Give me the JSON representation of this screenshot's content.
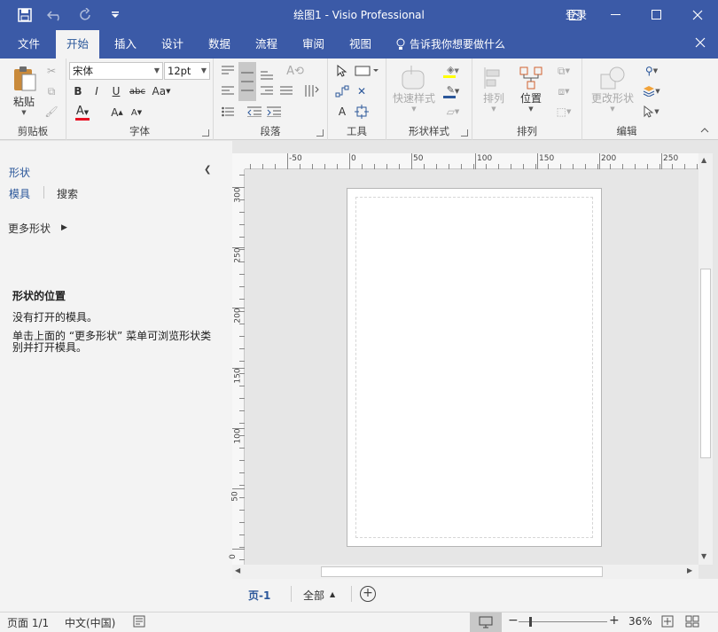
{
  "titlebar": {
    "title": "绘图1 - Visio Professional",
    "login": "登录"
  },
  "tabs": [
    "文件",
    "开始",
    "插入",
    "设计",
    "数据",
    "流程",
    "审阅",
    "视图"
  ],
  "tellme": "告诉我你想要做什么",
  "ribbon": {
    "clipboard": {
      "label": "剪贴板",
      "paste": "粘贴"
    },
    "font": {
      "label": "字体",
      "font_name": "宋体",
      "font_size": "12pt"
    },
    "paragraph": {
      "label": "段落"
    },
    "tools": {
      "label": "工具"
    },
    "shapestyles": {
      "label": "形状样式",
      "quick_styles": "快速样式"
    },
    "arrange": {
      "label": "排列",
      "arrange_btn": "排列",
      "position": "位置"
    },
    "editing": {
      "label": "编辑",
      "change_shape": "更改形状"
    }
  },
  "shapes_panel": {
    "title": "形状",
    "tab_stencils": "模具",
    "tab_search": "搜索",
    "more_shapes": "更多形状",
    "info_title": "形状的位置",
    "info_line1": "没有打开的模具。",
    "info_line2": "单击上面的 “更多形状” 菜单可浏览形状类别并打开模具。"
  },
  "rulers": {
    "h_labels": [
      "-50",
      "0",
      "50",
      "100",
      "150",
      "200",
      "250"
    ],
    "v_labels": [
      "300",
      "250",
      "200",
      "150",
      "100",
      "50",
      "0"
    ]
  },
  "page_tabs": {
    "page": "页-1",
    "all": "全部"
  },
  "status": {
    "page": "页面 1/1",
    "language": "中文(中国)",
    "zoom": "36%"
  },
  "colors": {
    "accent": "#3b5aa7",
    "font_color": "#e81123",
    "highlight": "#ffff00"
  }
}
